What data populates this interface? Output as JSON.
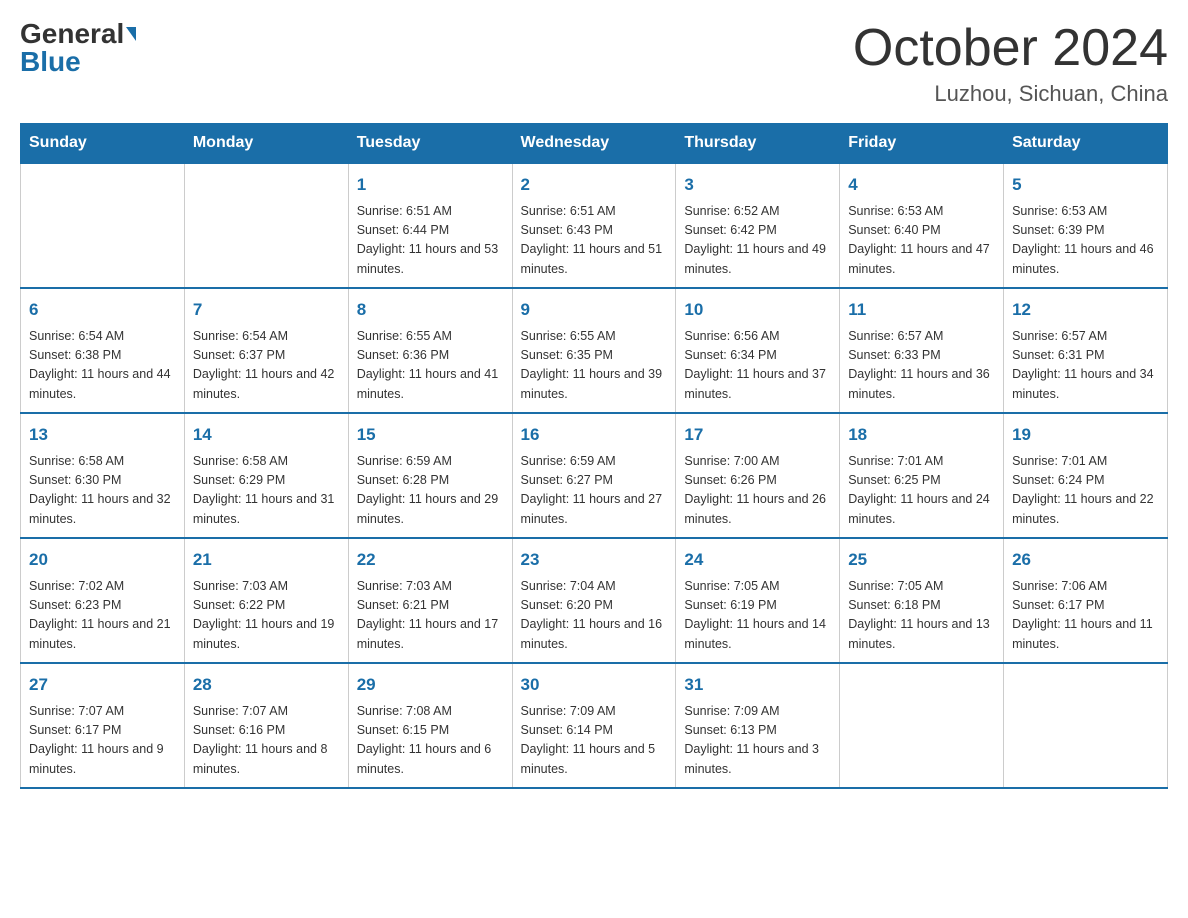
{
  "header": {
    "logo_general": "General",
    "logo_blue": "Blue",
    "month_title": "October 2024",
    "location": "Luzhou, Sichuan, China"
  },
  "weekdays": [
    "Sunday",
    "Monday",
    "Tuesday",
    "Wednesday",
    "Thursday",
    "Friday",
    "Saturday"
  ],
  "weeks": [
    [
      {
        "day": "",
        "sunrise": "",
        "sunset": "",
        "daylight": ""
      },
      {
        "day": "",
        "sunrise": "",
        "sunset": "",
        "daylight": ""
      },
      {
        "day": "1",
        "sunrise": "Sunrise: 6:51 AM",
        "sunset": "Sunset: 6:44 PM",
        "daylight": "Daylight: 11 hours and 53 minutes."
      },
      {
        "day": "2",
        "sunrise": "Sunrise: 6:51 AM",
        "sunset": "Sunset: 6:43 PM",
        "daylight": "Daylight: 11 hours and 51 minutes."
      },
      {
        "day": "3",
        "sunrise": "Sunrise: 6:52 AM",
        "sunset": "Sunset: 6:42 PM",
        "daylight": "Daylight: 11 hours and 49 minutes."
      },
      {
        "day": "4",
        "sunrise": "Sunrise: 6:53 AM",
        "sunset": "Sunset: 6:40 PM",
        "daylight": "Daylight: 11 hours and 47 minutes."
      },
      {
        "day": "5",
        "sunrise": "Sunrise: 6:53 AM",
        "sunset": "Sunset: 6:39 PM",
        "daylight": "Daylight: 11 hours and 46 minutes."
      }
    ],
    [
      {
        "day": "6",
        "sunrise": "Sunrise: 6:54 AM",
        "sunset": "Sunset: 6:38 PM",
        "daylight": "Daylight: 11 hours and 44 minutes."
      },
      {
        "day": "7",
        "sunrise": "Sunrise: 6:54 AM",
        "sunset": "Sunset: 6:37 PM",
        "daylight": "Daylight: 11 hours and 42 minutes."
      },
      {
        "day": "8",
        "sunrise": "Sunrise: 6:55 AM",
        "sunset": "Sunset: 6:36 PM",
        "daylight": "Daylight: 11 hours and 41 minutes."
      },
      {
        "day": "9",
        "sunrise": "Sunrise: 6:55 AM",
        "sunset": "Sunset: 6:35 PM",
        "daylight": "Daylight: 11 hours and 39 minutes."
      },
      {
        "day": "10",
        "sunrise": "Sunrise: 6:56 AM",
        "sunset": "Sunset: 6:34 PM",
        "daylight": "Daylight: 11 hours and 37 minutes."
      },
      {
        "day": "11",
        "sunrise": "Sunrise: 6:57 AM",
        "sunset": "Sunset: 6:33 PM",
        "daylight": "Daylight: 11 hours and 36 minutes."
      },
      {
        "day": "12",
        "sunrise": "Sunrise: 6:57 AM",
        "sunset": "Sunset: 6:31 PM",
        "daylight": "Daylight: 11 hours and 34 minutes."
      }
    ],
    [
      {
        "day": "13",
        "sunrise": "Sunrise: 6:58 AM",
        "sunset": "Sunset: 6:30 PM",
        "daylight": "Daylight: 11 hours and 32 minutes."
      },
      {
        "day": "14",
        "sunrise": "Sunrise: 6:58 AM",
        "sunset": "Sunset: 6:29 PM",
        "daylight": "Daylight: 11 hours and 31 minutes."
      },
      {
        "day": "15",
        "sunrise": "Sunrise: 6:59 AM",
        "sunset": "Sunset: 6:28 PM",
        "daylight": "Daylight: 11 hours and 29 minutes."
      },
      {
        "day": "16",
        "sunrise": "Sunrise: 6:59 AM",
        "sunset": "Sunset: 6:27 PM",
        "daylight": "Daylight: 11 hours and 27 minutes."
      },
      {
        "day": "17",
        "sunrise": "Sunrise: 7:00 AM",
        "sunset": "Sunset: 6:26 PM",
        "daylight": "Daylight: 11 hours and 26 minutes."
      },
      {
        "day": "18",
        "sunrise": "Sunrise: 7:01 AM",
        "sunset": "Sunset: 6:25 PM",
        "daylight": "Daylight: 11 hours and 24 minutes."
      },
      {
        "day": "19",
        "sunrise": "Sunrise: 7:01 AM",
        "sunset": "Sunset: 6:24 PM",
        "daylight": "Daylight: 11 hours and 22 minutes."
      }
    ],
    [
      {
        "day": "20",
        "sunrise": "Sunrise: 7:02 AM",
        "sunset": "Sunset: 6:23 PM",
        "daylight": "Daylight: 11 hours and 21 minutes."
      },
      {
        "day": "21",
        "sunrise": "Sunrise: 7:03 AM",
        "sunset": "Sunset: 6:22 PM",
        "daylight": "Daylight: 11 hours and 19 minutes."
      },
      {
        "day": "22",
        "sunrise": "Sunrise: 7:03 AM",
        "sunset": "Sunset: 6:21 PM",
        "daylight": "Daylight: 11 hours and 17 minutes."
      },
      {
        "day": "23",
        "sunrise": "Sunrise: 7:04 AM",
        "sunset": "Sunset: 6:20 PM",
        "daylight": "Daylight: 11 hours and 16 minutes."
      },
      {
        "day": "24",
        "sunrise": "Sunrise: 7:05 AM",
        "sunset": "Sunset: 6:19 PM",
        "daylight": "Daylight: 11 hours and 14 minutes."
      },
      {
        "day": "25",
        "sunrise": "Sunrise: 7:05 AM",
        "sunset": "Sunset: 6:18 PM",
        "daylight": "Daylight: 11 hours and 13 minutes."
      },
      {
        "day": "26",
        "sunrise": "Sunrise: 7:06 AM",
        "sunset": "Sunset: 6:17 PM",
        "daylight": "Daylight: 11 hours and 11 minutes."
      }
    ],
    [
      {
        "day": "27",
        "sunrise": "Sunrise: 7:07 AM",
        "sunset": "Sunset: 6:17 PM",
        "daylight": "Daylight: 11 hours and 9 minutes."
      },
      {
        "day": "28",
        "sunrise": "Sunrise: 7:07 AM",
        "sunset": "Sunset: 6:16 PM",
        "daylight": "Daylight: 11 hours and 8 minutes."
      },
      {
        "day": "29",
        "sunrise": "Sunrise: 7:08 AM",
        "sunset": "Sunset: 6:15 PM",
        "daylight": "Daylight: 11 hours and 6 minutes."
      },
      {
        "day": "30",
        "sunrise": "Sunrise: 7:09 AM",
        "sunset": "Sunset: 6:14 PM",
        "daylight": "Daylight: 11 hours and 5 minutes."
      },
      {
        "day": "31",
        "sunrise": "Sunrise: 7:09 AM",
        "sunset": "Sunset: 6:13 PM",
        "daylight": "Daylight: 11 hours and 3 minutes."
      },
      {
        "day": "",
        "sunrise": "",
        "sunset": "",
        "daylight": ""
      },
      {
        "day": "",
        "sunrise": "",
        "sunset": "",
        "daylight": ""
      }
    ]
  ]
}
